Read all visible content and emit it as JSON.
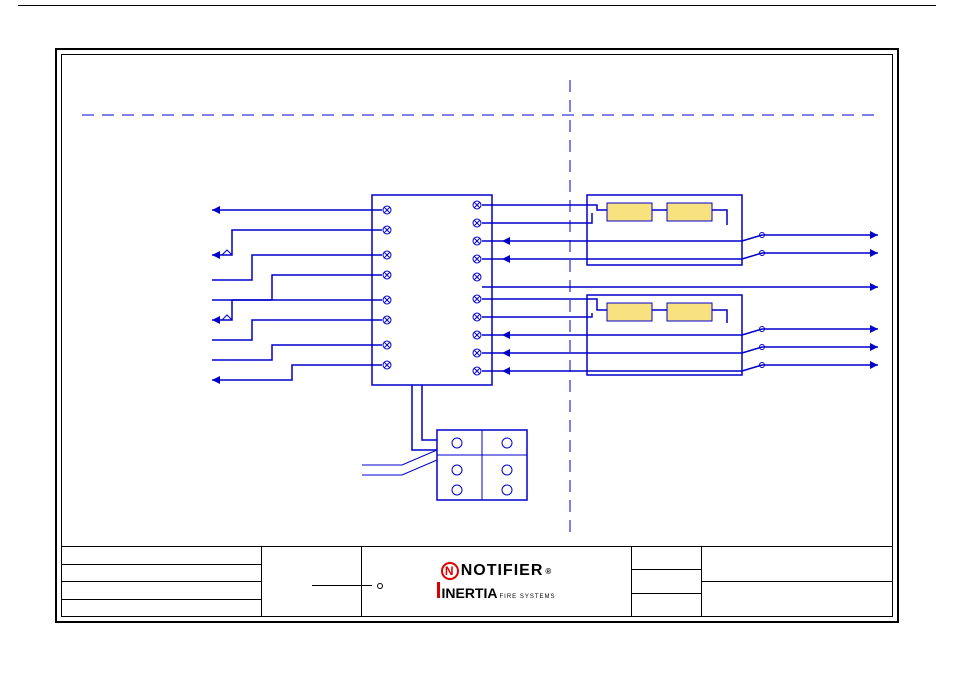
{
  "logo": {
    "brand1": "NOTIFIER",
    "brand1_reg": "®",
    "brand2": "INERTIA",
    "brand2_sub": "FIRE SYSTEMS"
  },
  "diagram": {
    "type": "wiring-schematic",
    "main_module": {
      "terminals_left": 8,
      "terminals_right": 10
    },
    "base_module": {
      "terminals": 6
    },
    "relay_blocks": 4,
    "switch_groups": [
      {
        "count": 2
      },
      {
        "count": 3
      }
    ]
  }
}
